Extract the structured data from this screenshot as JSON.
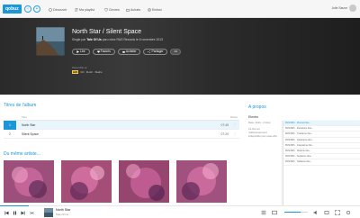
{
  "colors": {
    "accent": "#1b97d8",
    "hero_bg": "#2a2a2a",
    "hifi": "#f2c94c"
  },
  "app": {
    "logo": "qobuz"
  },
  "nav": {
    "items": [
      {
        "label": "Découvrir",
        "icon": "compass-icon"
      },
      {
        "label": "Ma playlist",
        "icon": "playlist-icon"
      },
      {
        "label": "Genres",
        "icon": "heart-icon"
      },
      {
        "label": "Achats",
        "icon": "bag-icon"
      },
      {
        "label": "Emissi",
        "icon": "broadcast-icon"
      }
    ]
  },
  "user": {
    "name": "Julie Sauve"
  },
  "hero": {
    "title": "North Star / Silent Space",
    "subtitle_prefix": "Single par",
    "artist": "Tale Of Us",
    "subtitle_suffix": "paru chez R&S Records le 6 novembre 2013",
    "buttons": [
      "Lire",
      "Favoris",
      "Acheter",
      "Partager",
      "•••"
    ],
    "available_label": "Disponible en",
    "hifi_badge": "HiFi",
    "hifi_text": "CD · FLAC · Studio"
  },
  "tracks": {
    "section_title": "Titres de l'album",
    "header_title": "Titre",
    "header_duration": "Durée",
    "rows": [
      {
        "num": "1",
        "title": "North Star",
        "duration": "07:45",
        "active": true
      },
      {
        "num": "2",
        "title": "Silent Space",
        "duration": "07:20",
        "active": false
      }
    ]
  },
  "related": {
    "section_title": "Du même artiste..."
  },
  "about": {
    "title": "A propos",
    "genre": "Electro",
    "meta": "Date: 2013 · 2 titres",
    "text": "Ce titre est malheureusement indisponible pour cette offre",
    "popularity": [
      "PM1/NP1 · Premier titre...",
      "PM1/NP1 · Deuxième titre...",
      "PM1/NP1 · Troisième titre...",
      "PM1/NP1 · Quatrième titre...",
      "PM1/NP1 · Cinquième titre...",
      "PM1/NP1 · Sixième titre...",
      "PM1/NP1 · Septième titre...",
      "PM1/NP1 · Huitième titre..."
    ]
  },
  "player": {
    "title": "North Star",
    "artist": "Tale Of Us",
    "progress": 0.08,
    "volume": 0.7
  }
}
